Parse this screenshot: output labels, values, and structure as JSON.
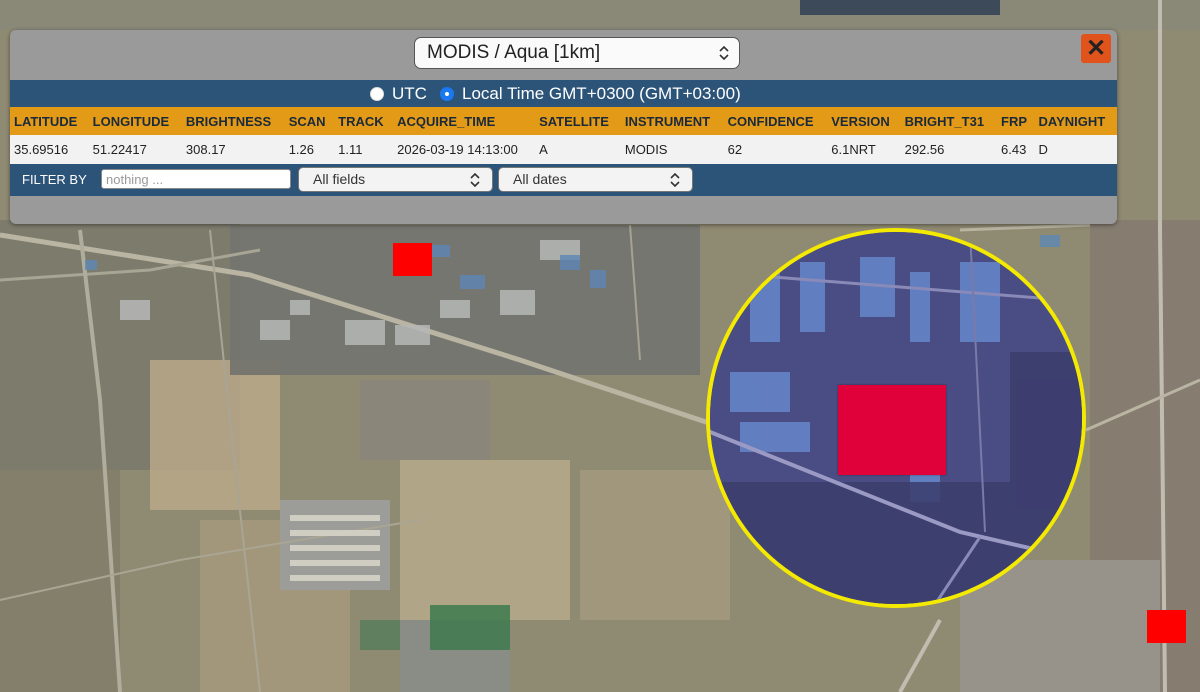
{
  "popup": {
    "source_select": "MODIS / Aqua [1km]",
    "close_label": "✕",
    "time_options": [
      {
        "label": "UTC",
        "selected": false
      },
      {
        "label": "Local Time GMT+0300 (GMT+03:00)",
        "selected": true
      }
    ],
    "columns": [
      "LATITUDE",
      "LONGITUDE",
      "BRIGHTNESS",
      "SCAN",
      "TRACK",
      "ACQUIRE_TIME",
      "SATELLITE",
      "INSTRUMENT",
      "CONFIDENCE",
      "VERSION",
      "BRIGHT_T31",
      "FRP",
      "DAYNIGHT"
    ],
    "rows": [
      [
        "35.69516",
        "51.22417",
        "308.17",
        "1.26",
        "1.11",
        "2026-03-19 14:13:00",
        "A",
        "MODIS",
        "62",
        "6.1NRT",
        "292.56",
        "6.43",
        "D"
      ]
    ],
    "filter": {
      "label": "FILTER BY",
      "placeholder": "nothing ...",
      "field_select": "All fields",
      "date_select": "All dates"
    }
  },
  "map": {
    "fire_marker_color": "#ff0000",
    "magnifier_border_color": "#f4e900",
    "panel_header_color": "#e39a17",
    "panel_bar_color": "#2c5478"
  }
}
